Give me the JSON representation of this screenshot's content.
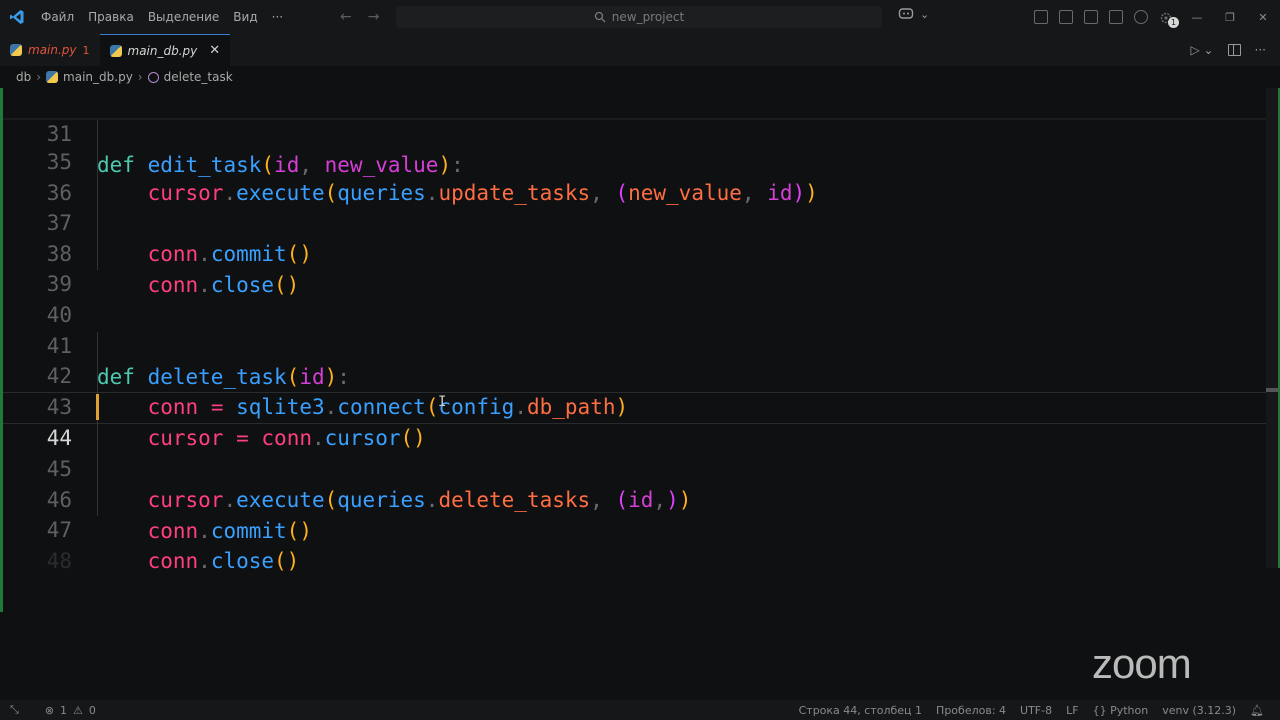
{
  "titlebar": {
    "menu": [
      "Файл",
      "Правка",
      "Выделение",
      "Вид",
      "···"
    ],
    "search_text": "new_project",
    "notification_count": "1"
  },
  "tabs": [
    {
      "label": "main.py",
      "badge": "1",
      "state": "inactive"
    },
    {
      "label": "main_db.py",
      "state": "active"
    }
  ],
  "breadcrumb": {
    "folder": "db",
    "file": "main_db.py",
    "symbol": "delete_task"
  },
  "editor": {
    "current_line": "44",
    "line_numbers": [
      "31",
      "35",
      "36",
      "37",
      "38",
      "39",
      "40",
      "41",
      "42",
      "43",
      "44",
      "45",
      "46",
      "47",
      "48"
    ],
    "code": {
      "l31": {
        "kw": "def",
        "fn": "edit_task",
        "p1": "id",
        "p2": "new_value"
      },
      "l35": {
        "obj": "cursor",
        "method": "execute",
        "mod": "queries",
        "attr": "update_tasks",
        "a1": "new_value",
        "a2": "id"
      },
      "l37": {
        "obj": "conn",
        "method": "commit"
      },
      "l38": {
        "obj": "conn",
        "method": "close"
      },
      "l41": {
        "kw": "def",
        "fn": "delete_task",
        "p1": "id"
      },
      "l42": {
        "var": "conn",
        "mod": "sqlite3",
        "method": "connect",
        "obj": "config",
        "attr": "db_path"
      },
      "l43": {
        "var": "cursor",
        "obj": "conn",
        "method": "cursor"
      },
      "l45": {
        "obj": "cursor",
        "method": "execute",
        "mod": "queries",
        "attr": "delete_tasks",
        "a1": "id"
      },
      "l46": {
        "obj": "conn",
        "method": "commit"
      },
      "l47": {
        "obj": "conn",
        "method": "close"
      }
    }
  },
  "watermark": "zoom",
  "statusbar": {
    "errors": "1",
    "warnings": "0",
    "position": "Строка 44, столбец 1",
    "spaces": "Пробелов: 4",
    "encoding": "UTF-8",
    "eol": "LF",
    "language": "{} Python",
    "interpreter": "venv (3.12.3)"
  },
  "colors": {
    "keyword": "#4ec9b0",
    "function": "#3aa0ff",
    "parameter": "#d63fd6",
    "variable": "#ff3f7f",
    "attribute": "#ff6d42",
    "bracket": "#ffb020",
    "accent": "#3a7bd5"
  }
}
